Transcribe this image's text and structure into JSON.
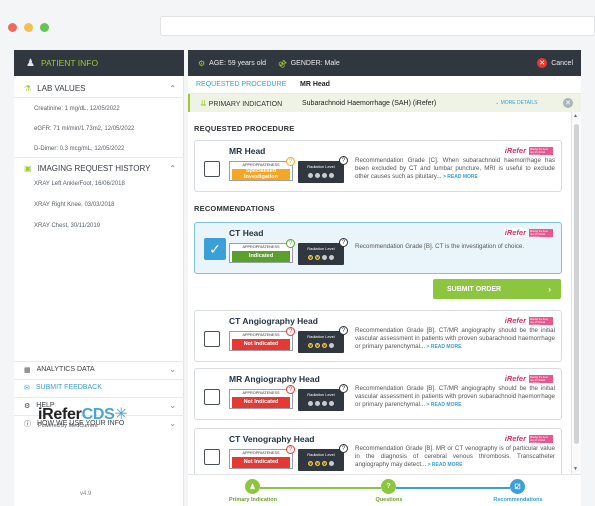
{
  "window": {
    "dots": [
      "#ec6a5e",
      "#f5bf4f",
      "#62c554"
    ]
  },
  "sidebar": {
    "header": {
      "icon": "patient-icon",
      "label": "PATIENT INFO"
    },
    "lab": {
      "title": "LAB VALUES",
      "items": [
        "Creatinine: 1 mg/dL, 12/05/2022",
        "eGFR: 71 ml/min/1.73m2, 12/05/2022",
        "D-Dimer: 0.3 mcg/mL, 12/05/2022"
      ]
    },
    "imaging": {
      "title": "IMAGING REQUEST HISTORY",
      "items": [
        "XRAY Left Ankle/Foot, 16/06/2018",
        "XRAY Right Knee, 03/03/2018",
        "XRAY Chest, 30/11/2019"
      ]
    },
    "bottom": {
      "analytics": "ANALYTICS DATA",
      "feedback": "SUBMIT FEEDBACK",
      "help": "HELP",
      "howuse": "HOW WE USE YOUR INFO"
    },
    "logo": {
      "name": "iRefer",
      "cds": "CDS",
      "powered": "Powered by MedCurrent",
      "version": "v4.9"
    }
  },
  "topbar": {
    "age": "AGE: 59 years old",
    "gender": "GENDER: Male",
    "cancel": "Cancel"
  },
  "requested": {
    "label": "REQUESTED PROCEDURE",
    "value": "MR Head"
  },
  "indication": {
    "label": "PRIMARY INDICATION",
    "value": "Subarachnoid Haemorrhage (SAH) (iRefer)",
    "more": "MORE DETAILS"
  },
  "sections": {
    "requested_heading": "REQUESTED PROCEDURE",
    "recommendations_heading": "RECOMMENDATIONS"
  },
  "common": {
    "appropriateness": "APPROPRIATENESS",
    "radiation_level": "Radiation Level",
    "read_more": "READ MORE",
    "irefer_mark": "iRefer",
    "irefer_tag": "Making the best use of clinical radiology"
  },
  "cards": [
    {
      "title": "MR Head",
      "appropriateness": "Specialised Investigation",
      "appr_color": "#f5a623",
      "radiation_on": 0,
      "text": "Recommendation Grade [C]. When subarachnoid haemorrhage has been excluded by CT and lumbar puncture, MRI is useful to exclude other causes such as pituitary...",
      "checked": false
    },
    {
      "title": "CT Head",
      "appropriateness": "Indicated",
      "appr_color": "#5aa02c",
      "radiation_on": 2,
      "text": "Recommendation Grade [B]. CT is the investigation of choice.",
      "checked": true
    },
    {
      "title": "CT Angiography Head",
      "appropriateness": "Not Indicated",
      "appr_color": "#e53935",
      "radiation_on": 3,
      "text": "Recommendation Grade [B]. CT/MR angiography should be the initial vascular assessment in patients with proven subarachnoid haemorrhage or primary parenchymal...",
      "checked": false
    },
    {
      "title": "MR Angiography Head",
      "appropriateness": "Not Indicated",
      "appr_color": "#e53935",
      "radiation_on": 0,
      "text": "Recommendation Grade [B]. CT/MR angiography should be the initial vascular assessment in patients with proven subarachnoid haemorrhage or primary parenchymal...",
      "checked": false
    },
    {
      "title": "CT Venography Head",
      "appropriateness": "Not Indicated",
      "appr_color": "#e53935",
      "radiation_on": 3,
      "text": "Recommendation Grade [B]. MR or CT venography is of particular value in the diagnosis of cerebral venous thrombosis. Transcatheter angiography may detect...",
      "checked": false
    }
  ],
  "submit": {
    "label": "SUBMIT ORDER",
    "arrow": "›"
  },
  "stepper": {
    "steps": [
      {
        "label": "Primary Indication",
        "icon": "person-icon"
      },
      {
        "label": "Questions",
        "icon": "question-icon"
      },
      {
        "label": "Recommendations",
        "icon": "checklist-icon"
      }
    ],
    "colors": {
      "done": "#8cc63f",
      "active": "#3b9fd8"
    }
  }
}
